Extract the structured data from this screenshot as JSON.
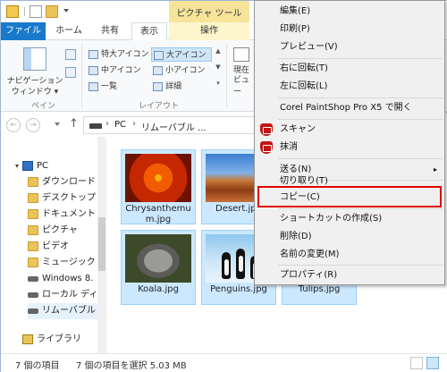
{
  "titlebar": {
    "context_tab": "ピクチャ ツール",
    "title_partial": "リ"
  },
  "ribbon_tabs": {
    "file": "ファイル",
    "home": "ホーム",
    "share": "共有",
    "view": "表示",
    "manage": "操作"
  },
  "ribbon": {
    "nav_pane_label_line1": "ナビゲーション",
    "nav_pane_label_line2": "ウィンドウ ▾",
    "pane_group": "ペイン",
    "layout_group": "レイアウト",
    "layout_items": [
      "特大アイコン",
      "大アイコン",
      "中アイコン",
      "小アイコン",
      "一覧",
      "詳細"
    ],
    "current_view_line1": "現在",
    "current_view_line2": "ビュー"
  },
  "address": {
    "pc": "PC",
    "location": "リムーバブル ..."
  },
  "nav_tree": [
    {
      "label": "PC",
      "icon": "pc-icon"
    },
    {
      "label": "ダウンロード",
      "icon": "folder-icon"
    },
    {
      "label": "デスクトップ",
      "icon": "folder-icon"
    },
    {
      "label": "ドキュメント",
      "icon": "folder-icon"
    },
    {
      "label": "ピクチャ",
      "icon": "folder-icon"
    },
    {
      "label": "ビデオ",
      "icon": "folder-icon"
    },
    {
      "label": "ミュージック",
      "icon": "folder-icon"
    },
    {
      "label": "Windows 8.",
      "icon": "drive-icon"
    },
    {
      "label": "ローカル ディス",
      "icon": "drive-icon"
    },
    {
      "label": "リムーバブル デ",
      "icon": "removable-drive-icon"
    },
    {
      "label": "ライブラリ",
      "icon": "library-icon"
    }
  ],
  "files": [
    {
      "name_line1": "Chrysanthemu",
      "name_line2": "m.jpg"
    },
    {
      "name_line1": "Desert.jpg",
      "name_line2": ""
    },
    {
      "name_line1": "Koala.jpg",
      "name_line2": ""
    },
    {
      "name_line1": "Penguins.jpg",
      "name_line2": ""
    },
    {
      "name_line1": "Tulips.jpg",
      "name_line2": ""
    }
  ],
  "status": {
    "item_count": "7 個の項目",
    "selection": "7 個の項目を選択 5.03 MB"
  },
  "context_menu": {
    "items": [
      {
        "label": "編集(E)"
      },
      {
        "label": "印刷(P)"
      },
      {
        "label": "プレビュー(V)"
      },
      {
        "label": "右に回転(T)"
      },
      {
        "label": "左に回転(L)"
      },
      {
        "label": "Corel PaintShop Pro X5 で開く"
      },
      {
        "label": "スキャン"
      },
      {
        "label": "抹消"
      },
      {
        "label": "送る(N)"
      },
      {
        "label": "切り取り(T)"
      },
      {
        "label": "コピー(C)"
      },
      {
        "label": "ショートカットの作成(S)"
      },
      {
        "label": "削除(D)"
      },
      {
        "label": "名前の変更(M)"
      },
      {
        "label": "プロパティ(R)"
      }
    ],
    "submenu_arrow": "▸",
    "highlight_color": "#e00000"
  },
  "colors": {
    "file_tab": "#1979ca",
    "context_tab": "#f6e49a",
    "selection": "#cce8ff"
  }
}
